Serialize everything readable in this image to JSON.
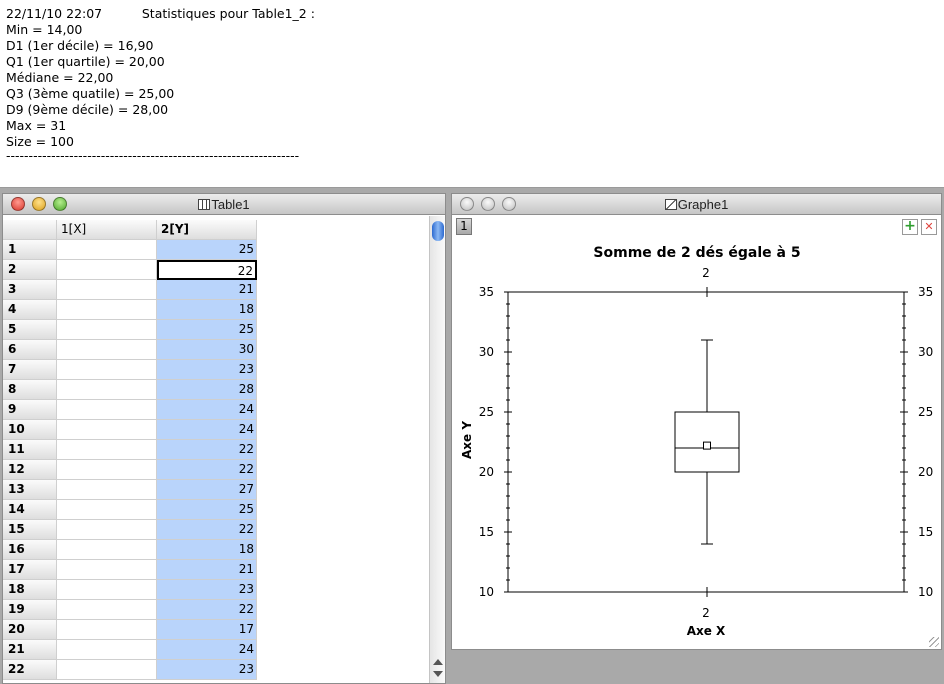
{
  "stats": {
    "header": "22/11/10 22:07          Statistiques pour Table1_2 :",
    "lines": [
      "Min = 14,00",
      "D1 (1er décile) = 16,90",
      "Q1 (1er quartile) = 20,00",
      "Médiane = 22,00",
      "Q3 (3ème quatile) = 25,00",
      "D9 (9ème décile) = 28,00",
      "Max = 31",
      "Size = 100"
    ],
    "separator": "-----------------------------------------------------------------"
  },
  "table_window": {
    "title": "Table1",
    "columns": [
      "1[X]",
      "2[Y]"
    ],
    "rows": [
      {
        "n": "1",
        "x": "",
        "y": "25"
      },
      {
        "n": "2",
        "x": "",
        "y": "22"
      },
      {
        "n": "3",
        "x": "",
        "y": "21"
      },
      {
        "n": "4",
        "x": "",
        "y": "18"
      },
      {
        "n": "5",
        "x": "",
        "y": "25"
      },
      {
        "n": "6",
        "x": "",
        "y": "30"
      },
      {
        "n": "7",
        "x": "",
        "y": "23"
      },
      {
        "n": "8",
        "x": "",
        "y": "28"
      },
      {
        "n": "9",
        "x": "",
        "y": "24"
      },
      {
        "n": "10",
        "x": "",
        "y": "24"
      },
      {
        "n": "11",
        "x": "",
        "y": "22"
      },
      {
        "n": "12",
        "x": "",
        "y": "22"
      },
      {
        "n": "13",
        "x": "",
        "y": "27"
      },
      {
        "n": "14",
        "x": "",
        "y": "25"
      },
      {
        "n": "15",
        "x": "",
        "y": "22"
      },
      {
        "n": "16",
        "x": "",
        "y": "18"
      },
      {
        "n": "17",
        "x": "",
        "y": "21"
      },
      {
        "n": "18",
        "x": "",
        "y": "23"
      },
      {
        "n": "19",
        "x": "",
        "y": "22"
      },
      {
        "n": "20",
        "x": "",
        "y": "17"
      },
      {
        "n": "21",
        "x": "",
        "y": "24"
      },
      {
        "n": "22",
        "x": "",
        "y": "23"
      }
    ],
    "selected_row": 2
  },
  "graph_window": {
    "title": "Graphe1",
    "page_tab": "1",
    "add_label": "+",
    "close_label": "✕"
  },
  "chart_data": {
    "type": "box",
    "title": "Somme de 2 dés égale à 5",
    "xlabel": "Axe X",
    "ylabel": "Axe Y",
    "category": "2",
    "ylim": [
      10,
      35
    ],
    "yticks": [
      10,
      15,
      20,
      25,
      30,
      35
    ],
    "box": {
      "min": 14,
      "q1": 20,
      "median": 22,
      "q3": 25,
      "max": 31,
      "mean": 22.2
    }
  },
  "colors": {
    "selected_column": "#b9d4fb",
    "close_red": "#e0443e",
    "add_green": "#2f9e2f"
  }
}
